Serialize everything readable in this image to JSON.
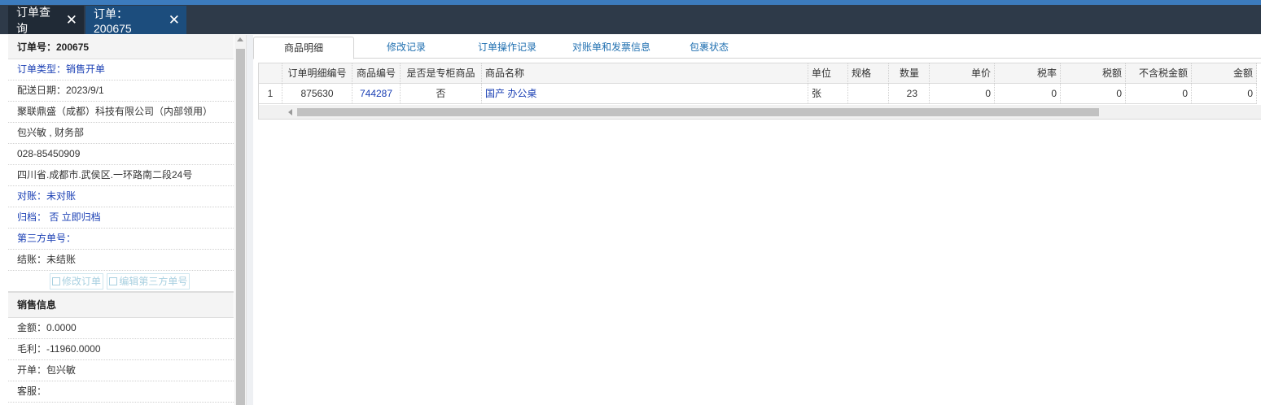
{
  "top_tabs": [
    {
      "label": "订单查询",
      "close": "✕"
    },
    {
      "label": "订单：200675",
      "close": "✕"
    }
  ],
  "order_info": {
    "order_no": "订单号：200675",
    "order_type": "订单类型：销售开单",
    "delivery_date": "配送日期：2023/9/1",
    "company": "聚联鼎盛（成都）科技有限公司（内部领用）",
    "contact": "包兴敏 , 财务部",
    "phone": "028-85450909",
    "address": "四川省.成都市.武侯区.一环路南二段24号",
    "reconcile": "对账：未对账",
    "archive": "归档： 否 立即归档",
    "third_party": "第三方单号：",
    "settle": "结账：未结账",
    "edit_order_btn": "修改订单",
    "edit_third_btn": "编辑第三方单号"
  },
  "sales_info": {
    "title": "销售信息",
    "amount": "金额：0.0000",
    "gross_profit": "毛利：-11960.0000",
    "issuer": "开单：包兴敏",
    "service": "客服："
  },
  "sub_tabs": [
    "商品明细",
    "修改记录",
    "订单操作记录",
    "对账单和发票信息",
    "包裹状态"
  ],
  "grid": {
    "columns": [
      "",
      "订单明细编号",
      "商品编号",
      "是否是专柜商品",
      "商品名称",
      "单位",
      "规格",
      "数量",
      "单价",
      "税率",
      "税额",
      "不含税金额",
      "金额"
    ],
    "rows": [
      [
        "1",
        "875630",
        "744287",
        "否",
        "国产 办公桌",
        "张",
        "",
        "23",
        "0",
        "0",
        "0",
        "0",
        "0"
      ]
    ]
  },
  "colors": {
    "top_strip": "#3c7bbd",
    "tab_bar": "#2e3a49",
    "active_tab": "#1c4d7d",
    "link": "#1a3fb4"
  }
}
